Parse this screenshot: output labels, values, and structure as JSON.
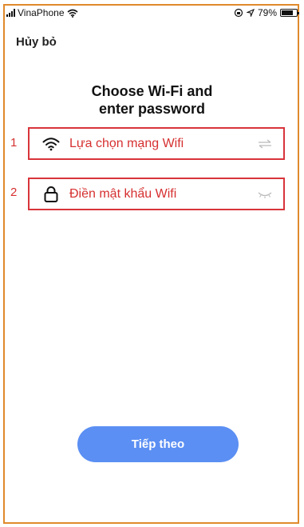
{
  "status_bar": {
    "carrier": "VinaPhone",
    "battery_percent": "79%",
    "battery_level": 0.79
  },
  "header": {
    "cancel_label": "Hủy bỏ"
  },
  "main": {
    "title_line1": "Choose Wi-Fi and",
    "title_line2": "enter password",
    "wifi_field": {
      "marker": "1",
      "placeholder": "Lựa chọn mạng Wifi",
      "icon": "wifi-icon",
      "trailing_icon": "switch-arrows-icon"
    },
    "password_field": {
      "marker": "2",
      "placeholder": "Điền mật khẩu Wifi",
      "icon": "lock-icon",
      "trailing_icon": "eye-closed-icon"
    }
  },
  "footer": {
    "next_label": "Tiếp theo"
  },
  "colors": {
    "accent": "#5b8ff3",
    "highlight": "#d9343b",
    "frame": "#e08a2c"
  }
}
